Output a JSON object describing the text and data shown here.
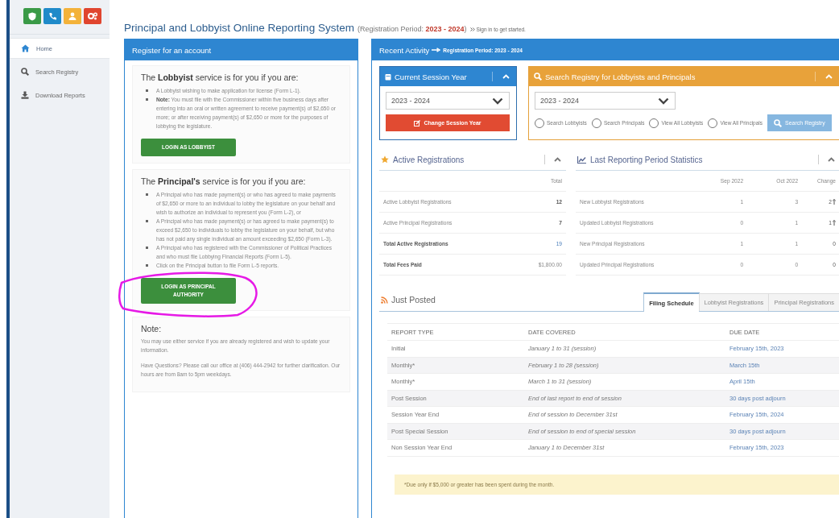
{
  "header_buttons": [
    {
      "kind": "shield",
      "color": "#3a9a47"
    },
    {
      "kind": "phone",
      "color": "#1f8ac9"
    },
    {
      "kind": "user",
      "color": "#f3b23a"
    },
    {
      "kind": "gears",
      "color": "#e0452f"
    }
  ],
  "sidebar": {
    "items": [
      {
        "label": "Home",
        "kind": "home",
        "selected": true
      },
      {
        "label": "Search Registry",
        "kind": "search",
        "selected": false
      },
      {
        "label": "Download Reports",
        "kind": "download",
        "selected": false
      }
    ]
  },
  "page_title": {
    "text": "Principal and Lobbyist Online Reporting System",
    "period_prefix": "(Registration Period: ",
    "period": "2023 - 2024",
    "period_suffix": ")",
    "sign_in": "Sign in to get started."
  },
  "register_panel": {
    "title": "Register for an account",
    "sections": [
      {
        "heading": "The **Lobbyist** service is for you if you are:",
        "bullets": [
          "A Lobbyist wishing to make application for license (Form L-1).",
          "**Note:** You must file with the Commissioner within five business days after entering into an oral or written agreement to receive payment(s) of $2,650 or more; or after receiving payment(s) of $2,650 or more for the purposes of lobbying the legislature."
        ],
        "button": "LOGIN AS LOBBYIST",
        "annotated": false
      },
      {
        "heading": "The **Principal's** service is for you if you are:",
        "bullets": [
          "A Principal who has made payment(s) or who has agreed to make payments of $2,650 or more to an individual to lobby the legislature on your behalf and wish to authorize an individual to represent you (Form L-2), or",
          "A Principal who has made payment(s) or has agreed to make payment(s) to exceed $2,650 to individuals to lobby the legislature on your behalf, but who has not paid any single individual an amount exceeding $2,650 (Form L-3).",
          "A Principal who has registered with the Commissioner of Political Practices and who must file Lobbying Financial Reports (Form L-5).",
          "Click on the Principal button to file Form L-5 reports."
        ],
        "button": "LOGIN AS PRINCIPAL AUTHORITY",
        "annotated": true
      }
    ],
    "note": {
      "heading": "Note:",
      "paragraphs": [
        "You may use either service if you are already registered and wish to update your information.",
        "Have Questions? Please call our office at (406) 444-2942 for further clarification. Our hours are from 8am to 5pm weekdays."
      ]
    }
  },
  "activity_panel": {
    "title": "Recent Activity",
    "subtitle": "Registration Period:  2023 - 2024",
    "session_card": {
      "title": "Current Session Year",
      "select": "2023 - 2024",
      "button": "Change Session Year"
    },
    "search_card": {
      "title": "Search Registry for Lobbyists and Principals",
      "select": "2023 - 2024",
      "radios": [
        {
          "label": "Search Lobbyists",
          "selected": false
        },
        {
          "label": "Search Principals",
          "selected": false
        },
        {
          "label": "View All Lobbyists",
          "selected": false
        },
        {
          "label": "View All Principals",
          "selected": false
        }
      ],
      "button": "Search Registry"
    },
    "active_registrations": {
      "title": "Active Registrations",
      "column": "Total",
      "rows": [
        {
          "label": "Active Lobbyist Registrations",
          "value": "12",
          "kind": "normal",
          "linked": false
        },
        {
          "label": "Active Principal Registrations",
          "value": "7",
          "kind": "normal",
          "linked": false
        },
        {
          "label": "Total Active Registrations",
          "value": "19",
          "kind": "total",
          "linked": true
        },
        {
          "label": "Total Fees Paid",
          "value": "$1,800.00",
          "kind": "total",
          "linked": false
        }
      ]
    },
    "statistics": {
      "title": "Last Reporting Period Statistics",
      "columns": [
        "Sep 2022",
        "Oct 2022",
        "Change"
      ],
      "rows": [
        {
          "label": "New Lobbyist Registrations",
          "values": [
            "1",
            "3",
            "2"
          ],
          "rising": true
        },
        {
          "label": "Updated Lobbyist Registrations",
          "values": [
            "0",
            "1",
            "1"
          ],
          "rising": true
        },
        {
          "label": "New Principal Registrations",
          "values": [
            "1",
            "1",
            "0"
          ],
          "rising": false
        },
        {
          "label": "Updated Principal Registrations",
          "values": [
            "0",
            "0",
            "0"
          ],
          "rising": false
        }
      ]
    },
    "just_posted": {
      "title": "Just Posted",
      "tabs": [
        {
          "label": "Filing Schedule",
          "selected": true
        },
        {
          "label": "Lobbyist Registrations",
          "selected": false
        },
        {
          "label": "Principal Registrations",
          "selected": false
        }
      ],
      "columns": [
        "REPORT TYPE",
        "DATE COVERED",
        "DUE DATE"
      ],
      "rows": [
        [
          "Initial",
          "January 1 to 31 (session)",
          "February 15th, 2023"
        ],
        [
          "Monthly*",
          "February 1 to 28 (session)",
          "March 15th"
        ],
        [
          "Monthly*",
          "March 1 to 31 (session)",
          "April 15th"
        ],
        [
          "Post Session",
          "End of last report to end of session",
          "30 days post adjourn"
        ],
        [
          "Session Year End",
          "End of session to December 31st",
          "February 15th, 2024"
        ],
        [
          "Post Special Session",
          "End of session to end of special session",
          "30 days post adjourn"
        ],
        [
          "Non Session Year End",
          "January 1 to December 31st",
          "February 15th, 2023"
        ]
      ],
      "footnote": "*Due only if $5,000 or greater has been spent during the month."
    }
  }
}
